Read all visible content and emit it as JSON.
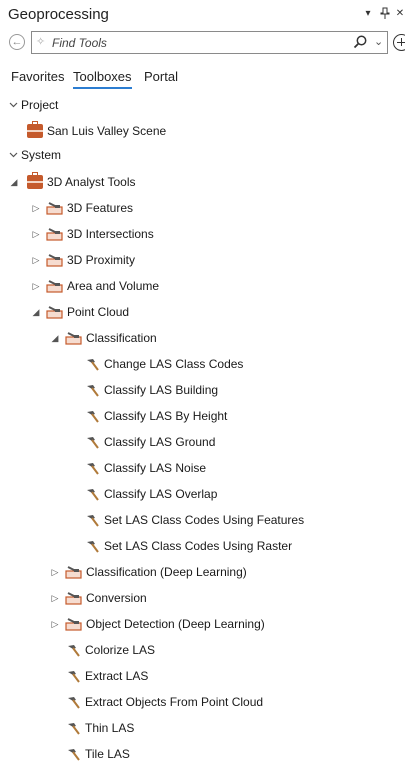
{
  "header": {
    "title": "Geoprocessing",
    "menu_glyph": "▾",
    "pin_glyph": "⊥",
    "close_glyph": "✕"
  },
  "search": {
    "placeholder": "Find Tools",
    "value": ""
  },
  "tabs": [
    {
      "label": "Favorites",
      "active": false
    },
    {
      "label": "Toolboxes",
      "active": true
    },
    {
      "label": "Portal",
      "active": false
    }
  ],
  "tree": {
    "project": {
      "label": "Project",
      "items": [
        {
          "label": "San Luis Valley Scene"
        }
      ]
    },
    "system": {
      "label": "System",
      "toolbox": {
        "label": "3D Analyst Tools",
        "toolsets": [
          {
            "label": "3D Features"
          },
          {
            "label": "3D Intersections"
          },
          {
            "label": "3D Proximity"
          },
          {
            "label": "Area and Volume"
          }
        ],
        "point_cloud": {
          "label": "Point Cloud",
          "classification": {
            "label": "Classification",
            "tools": [
              "Change LAS Class Codes",
              "Classify LAS Building",
              "Classify LAS By Height",
              "Classify LAS Ground",
              "Classify LAS Noise",
              "Classify LAS Overlap",
              "Set LAS Class Codes Using Features",
              "Set LAS Class Codes Using Raster"
            ]
          },
          "subsets": [
            {
              "label": "Classification (Deep Learning)"
            },
            {
              "label": "Conversion"
            },
            {
              "label": "Object Detection (Deep Learning)"
            }
          ],
          "tools": [
            "Colorize LAS",
            "Extract LAS",
            "Extract Objects From Point Cloud",
            "Thin LAS",
            "Tile LAS"
          ]
        }
      }
    }
  },
  "colors": {
    "accent": "#2c7dd1",
    "toolbox": "#c55a2c"
  }
}
